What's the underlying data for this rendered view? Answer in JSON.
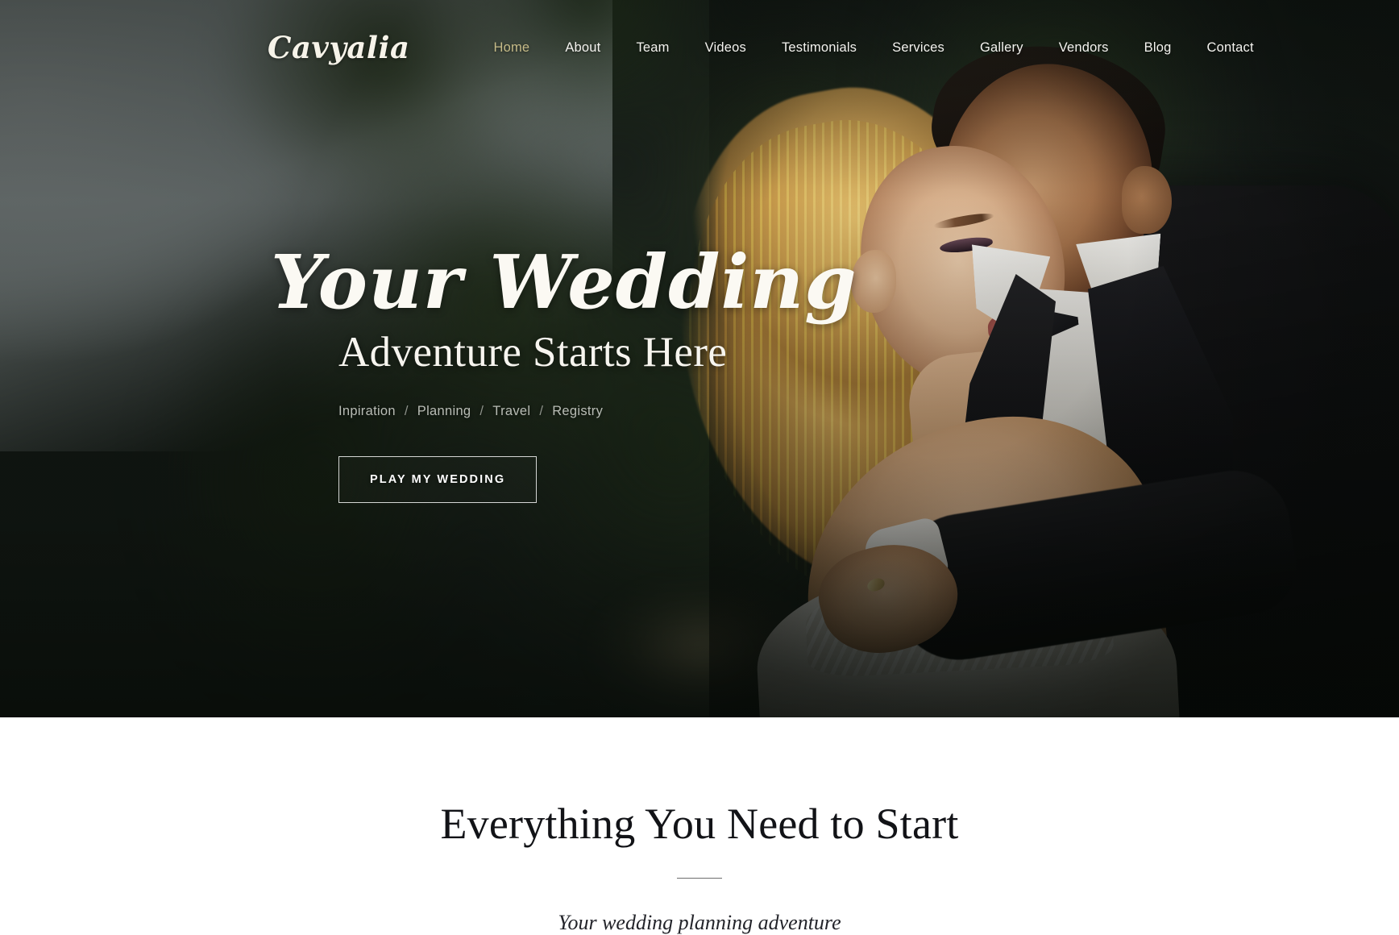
{
  "header": {
    "logo": "Cavyalia",
    "nav": [
      {
        "label": "Home",
        "active": true
      },
      {
        "label": "About",
        "active": false
      },
      {
        "label": "Team",
        "active": false
      },
      {
        "label": "Videos",
        "active": false
      },
      {
        "label": "Testimonials",
        "active": false
      },
      {
        "label": "Services",
        "active": false
      },
      {
        "label": "Gallery",
        "active": false
      },
      {
        "label": "Vendors",
        "active": false
      },
      {
        "label": "Blog",
        "active": false
      },
      {
        "label": "Contact",
        "active": false
      }
    ]
  },
  "hero": {
    "script_title": "Your Wedding",
    "serif_subtitle": "Adventure Starts Here",
    "tagline_items": [
      "Inpiration",
      "Planning",
      "Travel",
      "Registry"
    ],
    "tagline_separator": "/",
    "cta_label": "PLAY MY WEDDING"
  },
  "section": {
    "title": "Everything You Need to Start",
    "subtitle": "Your wedding planning adventure"
  },
  "colors": {
    "accent_gold": "#c6bb88",
    "nav_text": "#f4f3ef",
    "hero_text": "#fbf9f3",
    "tagline_text": "#b9bdb6",
    "section_title": "#121317",
    "divider": "#6d6d6d",
    "page_background": "#ffffff"
  }
}
